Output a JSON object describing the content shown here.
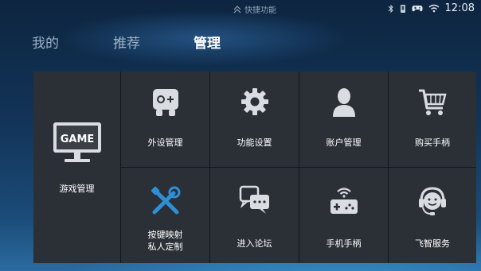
{
  "status_bar": {
    "quick_label": "快捷功能",
    "time": "12:08"
  },
  "tabs": [
    {
      "label": "我的",
      "active": false
    },
    {
      "label": "推荐",
      "active": false
    },
    {
      "label": "管理",
      "active": true
    }
  ],
  "tiles": [
    {
      "label": "游戏管理",
      "icon": "game-monitor-icon",
      "icon_text": "GAME"
    },
    {
      "label": "外设管理",
      "icon": "gamepad-icon"
    },
    {
      "label": "功能设置",
      "icon": "gear-icon"
    },
    {
      "label": "账户管理",
      "icon": "user-icon"
    },
    {
      "label": "购买手柄",
      "icon": "cart-icon"
    },
    {
      "label": "按键映射\n私人定制",
      "icon": "tools-icon"
    },
    {
      "label": "进入论坛",
      "icon": "chat-icon"
    },
    {
      "label": "手机手柄",
      "icon": "phone-controller-icon"
    },
    {
      "label": "飞智服务",
      "icon": "headset-icon"
    }
  ],
  "colors": {
    "tile_bg": "#2b3036",
    "icon_color": "#d9dde2",
    "accent_blue": "#2f8fd6"
  }
}
